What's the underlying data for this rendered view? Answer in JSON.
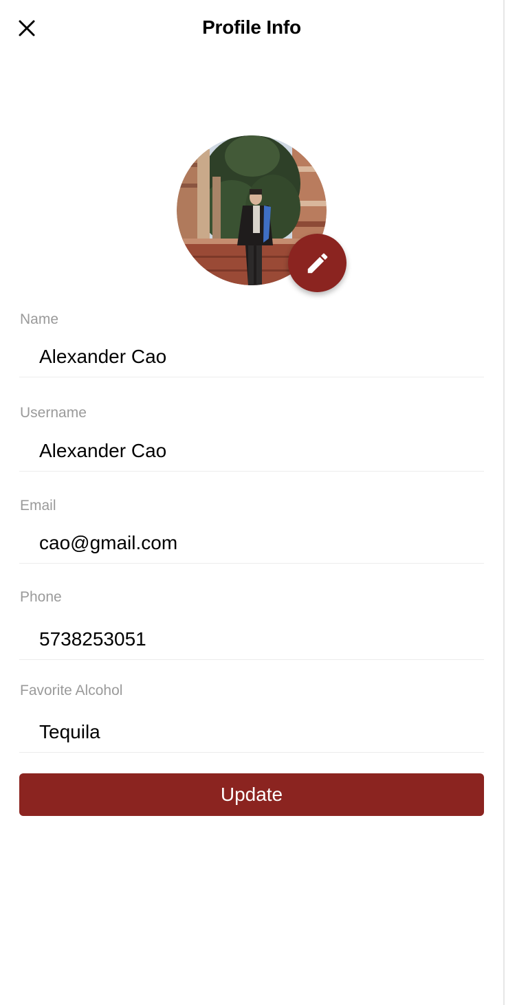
{
  "header": {
    "title": "Profile Info",
    "close_icon": "close-icon"
  },
  "avatar": {
    "edit_icon": "pencil-icon"
  },
  "fields": [
    {
      "label": "Name",
      "value": "Alexander Cao"
    },
    {
      "label": "Username",
      "value": "Alexander Cao"
    },
    {
      "label": "Email",
      "value": "cao@gmail.com"
    },
    {
      "label": "Phone",
      "value": "5738253051"
    },
    {
      "label": "Favorite Alcohol",
      "value": "Tequila"
    }
  ],
  "actions": {
    "update_label": "Update"
  },
  "colors": {
    "accent": "#8b2420",
    "label": "#9a9a9a",
    "divider": "#ececec"
  }
}
